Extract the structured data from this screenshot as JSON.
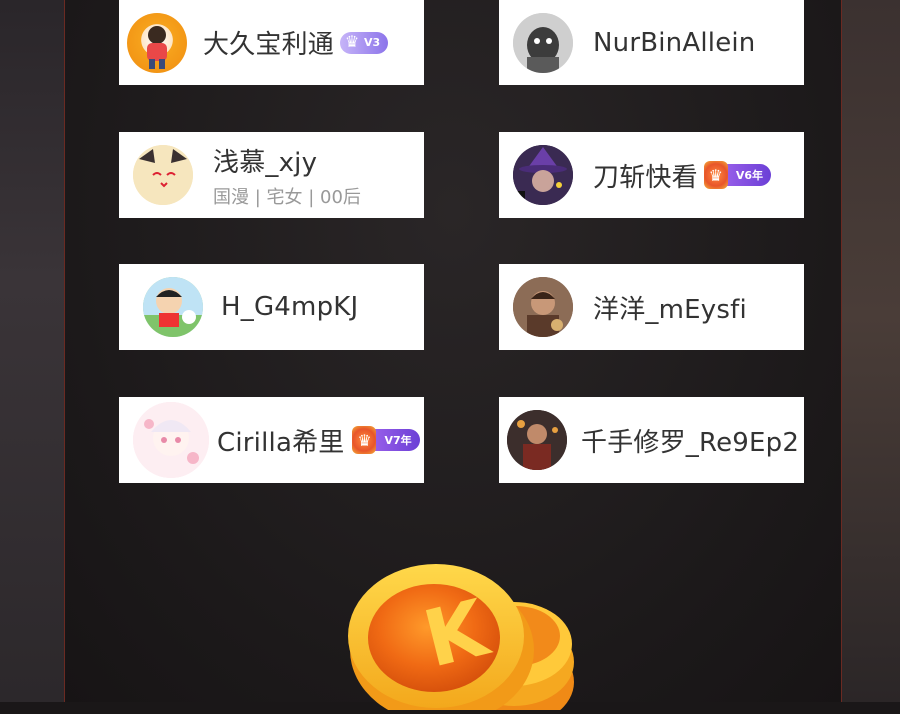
{
  "users": [
    {
      "name": "大久宝利通",
      "badge": "V3",
      "subtitle": ""
    },
    {
      "name": "NurBinAllein",
      "badge": "",
      "subtitle": ""
    },
    {
      "name": "浅慕_xjy",
      "badge": "",
      "subtitle": "国漫 | 宅女 | 00后"
    },
    {
      "name": "刀斩快看",
      "badge": "V6年",
      "subtitle": ""
    },
    {
      "name": "H_G4mpKJ",
      "badge": "",
      "subtitle": ""
    },
    {
      "name": "洋洋_mEysfi",
      "badge": "",
      "subtitle": ""
    },
    {
      "name": "Cirilla希里",
      "badge": "V7年",
      "subtitle": ""
    },
    {
      "name": "千手修罗_Re9Ep2",
      "badge": "",
      "subtitle": ""
    }
  ],
  "coin_letter": "K",
  "colors": {
    "background": "#1a1718",
    "card": "#ffffff",
    "border_accent": "#6b2a22",
    "coin_gold": "#f5b520",
    "coin_orange": "#e8641c",
    "badge_purple": "#7c5ce8"
  },
  "icons": {
    "badge": "crown-icon",
    "coin": "k-coin-icon"
  }
}
